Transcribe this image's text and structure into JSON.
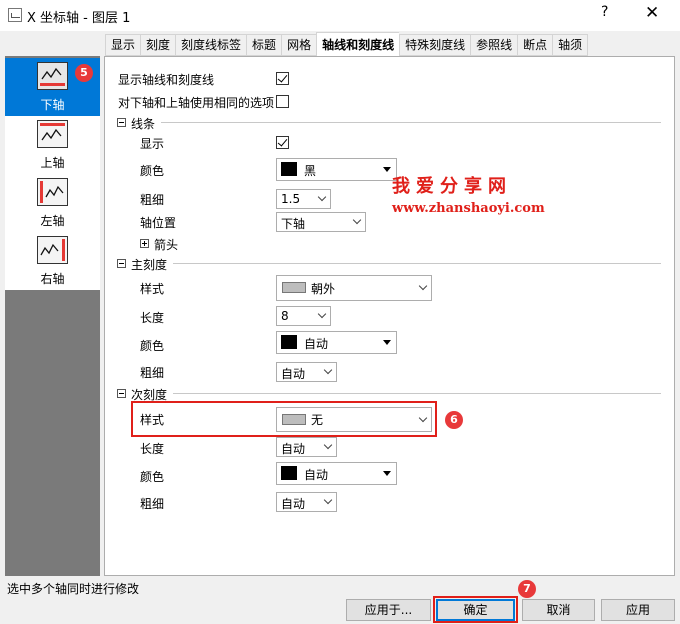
{
  "window": {
    "title": "X 坐标轴 - 图层 1",
    "help_label": "?",
    "close_label": "✕"
  },
  "tabs": [
    {
      "label": "显示"
    },
    {
      "label": "刻度"
    },
    {
      "label": "刻度线标签"
    },
    {
      "label": "标题"
    },
    {
      "label": "网格"
    },
    {
      "label": "轴线和刻度线",
      "active": true
    },
    {
      "label": "特殊刻度线"
    },
    {
      "label": "参照线"
    },
    {
      "label": "断点"
    },
    {
      "label": "轴须"
    }
  ],
  "sidebar": {
    "items": [
      {
        "label": "下轴",
        "icon": "bottom-axis-icon",
        "selected": true
      },
      {
        "label": "上轴",
        "icon": "top-axis-icon"
      },
      {
        "label": "左轴",
        "icon": "left-axis-icon"
      },
      {
        "label": "右轴",
        "icon": "right-axis-icon"
      }
    ]
  },
  "options": {
    "show_axis_label": "显示轴线和刻度线",
    "show_axis_checked": true,
    "same_options_label": "对下轴和上轴使用相同的选项",
    "same_options_checked": false
  },
  "line": {
    "section_label": "线条",
    "show_label": "显示",
    "show_checked": true,
    "color_label": "颜色",
    "color_value": "黑",
    "thickness_label": "粗细",
    "thickness_value": "1.5",
    "position_label": "轴位置",
    "position_value": "下轴",
    "arrow_label": "箭头"
  },
  "major_ticks": {
    "section_label": "主刻度",
    "style_label": "样式",
    "style_value": "朝外",
    "length_label": "长度",
    "length_value": "8",
    "color_label": "颜色",
    "color_value": "自动",
    "thickness_label": "粗细",
    "thickness_value": "自动"
  },
  "minor_ticks": {
    "section_label": "次刻度",
    "style_label": "样式",
    "style_value": "无",
    "length_label": "长度",
    "length_value": "自动",
    "color_label": "颜色",
    "color_value": "自动",
    "thickness_label": "粗细",
    "thickness_value": "自动"
  },
  "watermark": {
    "text": "我爱分享网",
    "url": "www.zhanshaoyi.com"
  },
  "annotations": {
    "badge5": "5",
    "badge6": "6",
    "badge7": "7"
  },
  "status": {
    "text": "选中多个轴同时进行修改"
  },
  "buttons": {
    "apply_to": "应用于...",
    "ok": "确定",
    "cancel": "取消",
    "apply": "应用"
  },
  "colors": {
    "accent": "#0078d7",
    "annotation_red": "#e0201a",
    "sidebar_bg": "#7a7a7a"
  }
}
